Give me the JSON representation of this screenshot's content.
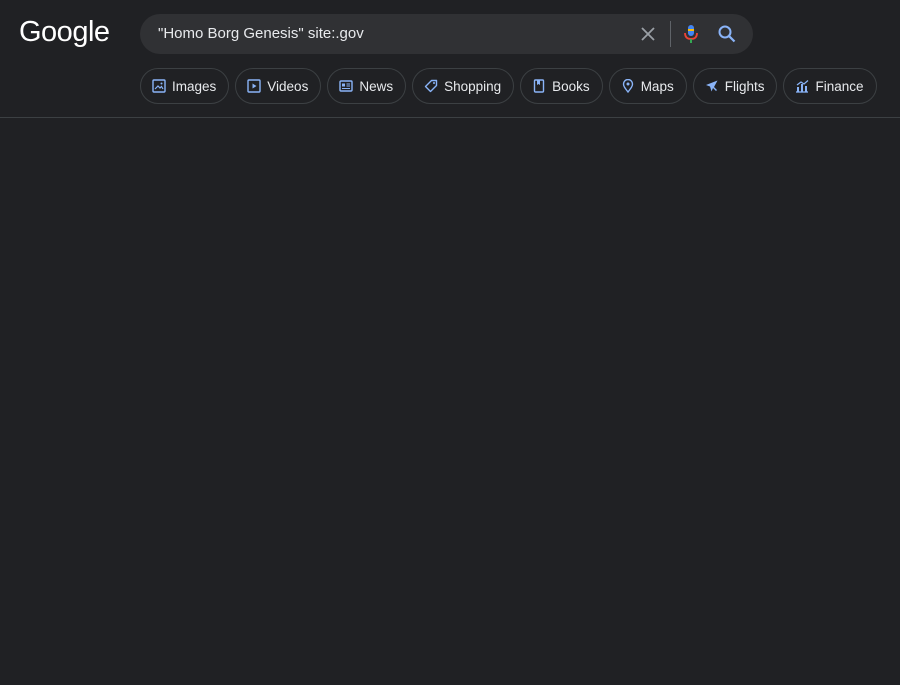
{
  "header": {
    "logo_text": "Google",
    "search": {
      "query": "\"Homo Borg Genesis\" site:.gov"
    },
    "chips": [
      {
        "label": "Images",
        "icon": "image-icon"
      },
      {
        "label": "Videos",
        "icon": "play-icon"
      },
      {
        "label": "News",
        "icon": "newspaper-icon"
      },
      {
        "label": "Shopping",
        "icon": "tag-icon"
      },
      {
        "label": "Books",
        "icon": "book-icon"
      },
      {
        "label": "Maps",
        "icon": "pin-icon"
      },
      {
        "label": "Flights",
        "icon": "plane-icon"
      },
      {
        "label": "Finance",
        "icon": "chart-icon"
      }
    ]
  },
  "colors": {
    "background": "#202124",
    "search_bg": "#303134",
    "chip_icon": "#8ab4f8",
    "border": "#3c4043"
  }
}
